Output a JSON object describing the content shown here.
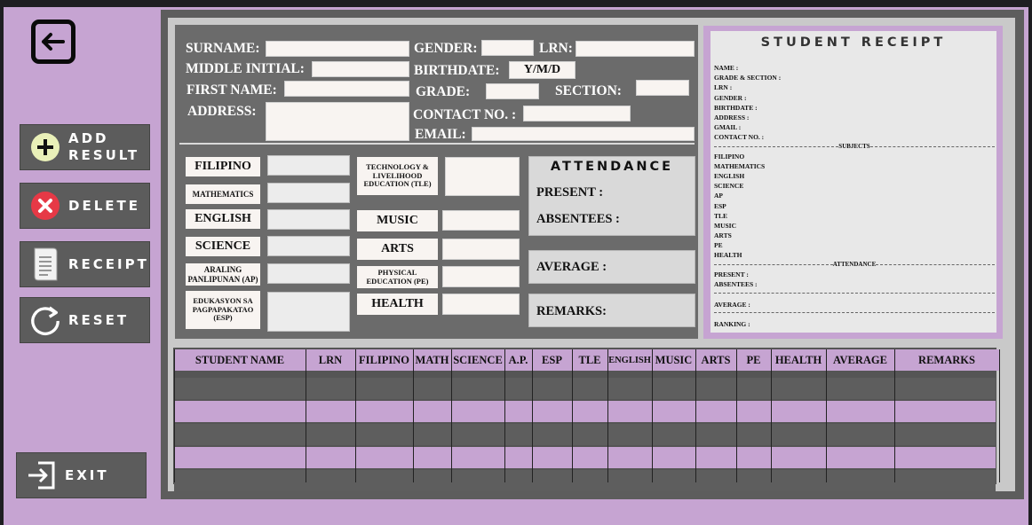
{
  "nav": {
    "back_icon": "back-arrow-icon"
  },
  "sidebar": {
    "items": [
      {
        "id": "add-result",
        "label": "ADD\nRESULT",
        "icon": "plus-circle-icon"
      },
      {
        "id": "delete",
        "label": "DELETE",
        "icon": "delete-x-icon"
      },
      {
        "id": "receipt",
        "label": "RECEIPT",
        "icon": "receipt-icon"
      },
      {
        "id": "reset",
        "label": "RESET",
        "icon": "reset-icon"
      },
      {
        "id": "exit",
        "label": "EXIT",
        "icon": "exit-icon"
      }
    ]
  },
  "form": {
    "surname": "SURNAME:",
    "gender": "GENDER:",
    "lrn": "LRN:",
    "middle_initial": "MIDDLE INITIAL:",
    "birthdate": "BIRTHDATE:",
    "birthdate_placeholder": "Y/M/D",
    "first_name": "FIRST NAME:",
    "grade": "GRADE:",
    "section": "SECTION:",
    "address": "ADDRESS:",
    "contact": "CONTACT NO. :",
    "email": "EMAIL:"
  },
  "subjects": {
    "filipino": "FILIPINO",
    "mathematics": "MATHEMATICS",
    "english": "ENGLISH",
    "science": "SCIENCE",
    "ap": "ARALING PANLIPUNAN (AP)",
    "esp": "EDUKASYON SA PAGPAPAKATAO (ESP)",
    "tle": "TECHNOLOGY & LIVELIHOOD EDUCATION (TLE)",
    "music": "MUSIC",
    "arts": "ARTS",
    "pe": "PHYSICAL EDUCATION (PE)",
    "health": "HEALTH"
  },
  "attendance": {
    "title": "ATTENDANCE",
    "present": "PRESENT :",
    "absentees": "ABSENTEES :"
  },
  "average_label": "AVERAGE :",
  "remarks_label": "REMARKS:",
  "receipt": {
    "title": "STUDENT RECEIPT",
    "lines": [
      "NAME :",
      "GRADE & SECTION :",
      "LRN :",
      "GENDER :",
      "BIRTHDATE :",
      "ADDRESS :",
      "GMAIL :",
      "CONTACT NO. :"
    ],
    "subjects_div": "SUBJECTS",
    "subjects": [
      "FILIPINO",
      "MATHEMATICS",
      "ENGLISH",
      "SCIENCE",
      "AP",
      "ESP",
      "TLE",
      "MUSIC",
      "ARTS",
      "PE",
      "HEALTH"
    ],
    "attendance_div": "ATTENDANCE",
    "present": "PRESENT :",
    "absentees": "ABSENTEES :",
    "average": "AVERAGE :",
    "ranking": "RANKING :"
  },
  "table": {
    "columns": [
      "STUDENT NAME",
      "LRN",
      "FILIPINO",
      "MATH",
      "SCIENCE",
      "A.P.",
      "ESP",
      "TLE",
      "ENGLISH",
      "MUSIC",
      "ARTS",
      "PE",
      "HEALTH",
      "AVERAGE",
      "REMARKS"
    ],
    "row_colors": [
      "#5e5e5e",
      "#c6a4d2",
      "#5e5e5e",
      "#c6a4d2",
      "#5e5e5e"
    ]
  }
}
